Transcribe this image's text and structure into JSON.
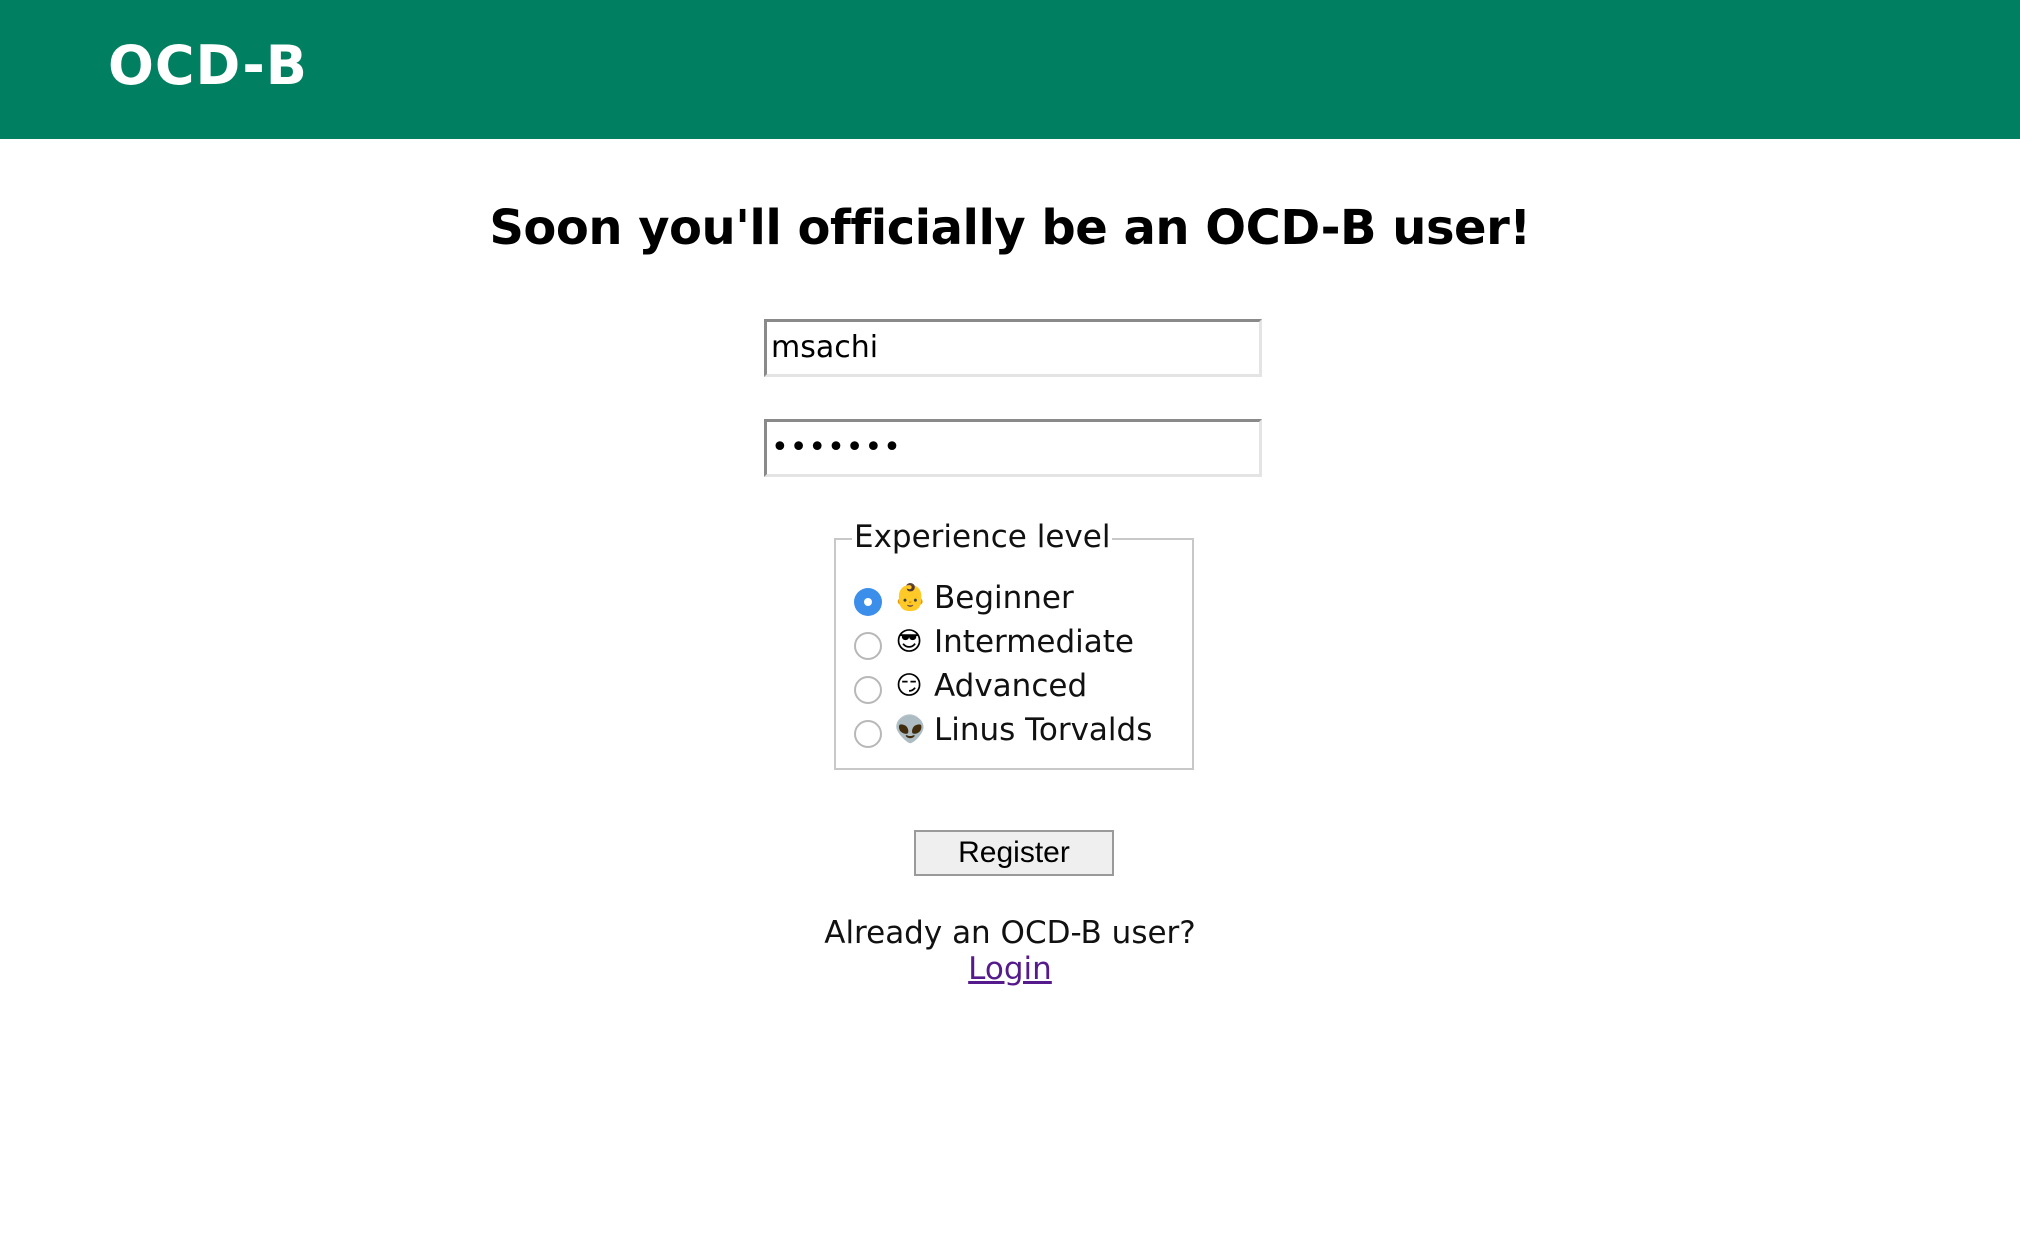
{
  "header": {
    "brand": "OCD-B",
    "background_color": "#008060"
  },
  "main": {
    "title": "Soon you'll officially be an OCD-B user!"
  },
  "form": {
    "username_value": "msachi",
    "password_value": "•••••••",
    "experience": {
      "legend": "Experience level",
      "selected": "Beginner",
      "options": [
        {
          "emoji": "👶",
          "icon": "baby-face-icon",
          "label": "Beginner",
          "checked": true
        },
        {
          "emoji": "😎",
          "icon": "sunglasses-face-icon",
          "label": "Intermediate",
          "checked": false
        },
        {
          "emoji": "😏",
          "icon": "smirking-face-icon",
          "label": "Advanced",
          "checked": false
        },
        {
          "emoji": "👽",
          "icon": "alien-icon",
          "label": "Linus Torvalds",
          "checked": false
        }
      ]
    },
    "register_label": "Register"
  },
  "footer": {
    "already_text": "Already an OCD-B user?",
    "login_label": "Login",
    "link_color": "#551a8b"
  }
}
